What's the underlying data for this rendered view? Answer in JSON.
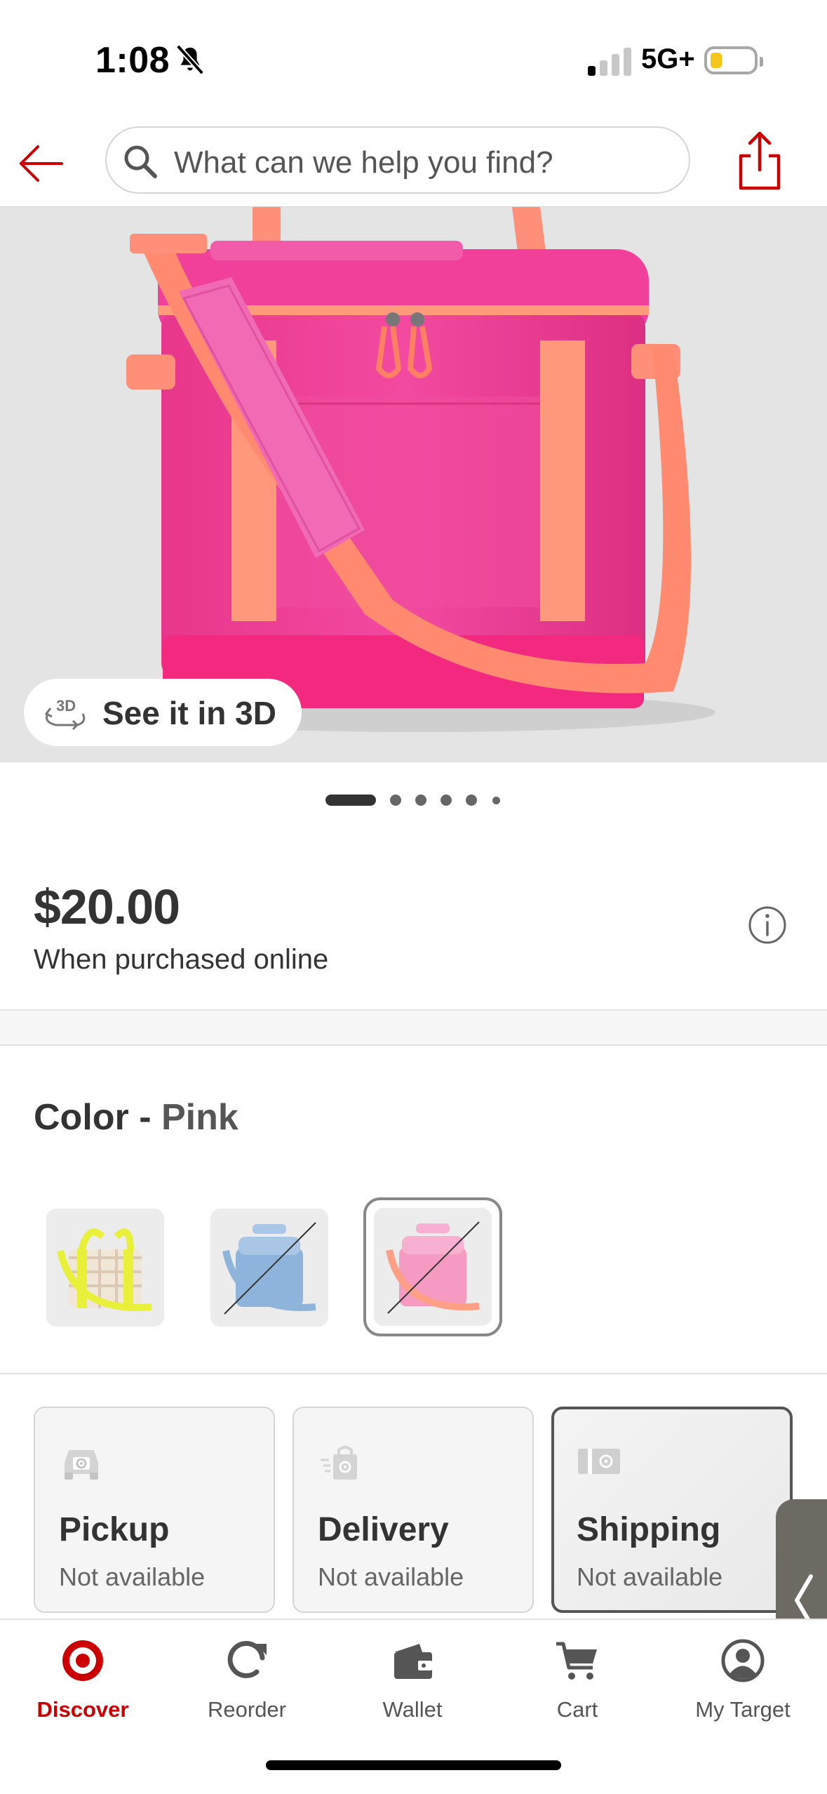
{
  "status_bar": {
    "time": "1:08",
    "network": "5G+",
    "icons": [
      "bell-slash-icon",
      "signal-icon",
      "battery-icon"
    ]
  },
  "header": {
    "search": {
      "placeholder": "What can we help you find?"
    },
    "icons": [
      "back-arrow-icon",
      "search-icon",
      "share-icon"
    ]
  },
  "gallery": {
    "see_3d_label": "See it in 3D",
    "dot_count": 6,
    "active_dot": 0
  },
  "price": {
    "amount": "$20.00",
    "note": "When purchased online"
  },
  "color": {
    "label": "Color",
    "separator": "-",
    "selected": "Pink",
    "swatches": [
      {
        "name": "yellow-check-cooler",
        "available": true,
        "color": "#e8f03a"
      },
      {
        "name": "blue-cooler",
        "available": false,
        "color": "#8fb4dc"
      },
      {
        "name": "pink-cooler",
        "available": false,
        "color": "#f59ac0",
        "selected": true
      }
    ]
  },
  "fulfillment": [
    {
      "title": "Pickup",
      "status": "Not available",
      "icon": "pickup-car-icon"
    },
    {
      "title": "Delivery",
      "status": "Not available",
      "icon": "delivery-bag-icon"
    },
    {
      "title": "Shipping",
      "status": "Not available",
      "icon": "shipping-box-icon",
      "selected": true
    }
  ],
  "bottom_nav": [
    {
      "label": "Discover",
      "active": true
    },
    {
      "label": "Reorder",
      "active": false
    },
    {
      "label": "Wallet",
      "active": false
    },
    {
      "label": "Cart",
      "active": false
    },
    {
      "label": "My Target",
      "active": false
    }
  ],
  "colors": {
    "brand_red": "#cc0000",
    "text": "#333333",
    "product_pink": "#f0388f",
    "strap_coral": "#ff8a70"
  }
}
